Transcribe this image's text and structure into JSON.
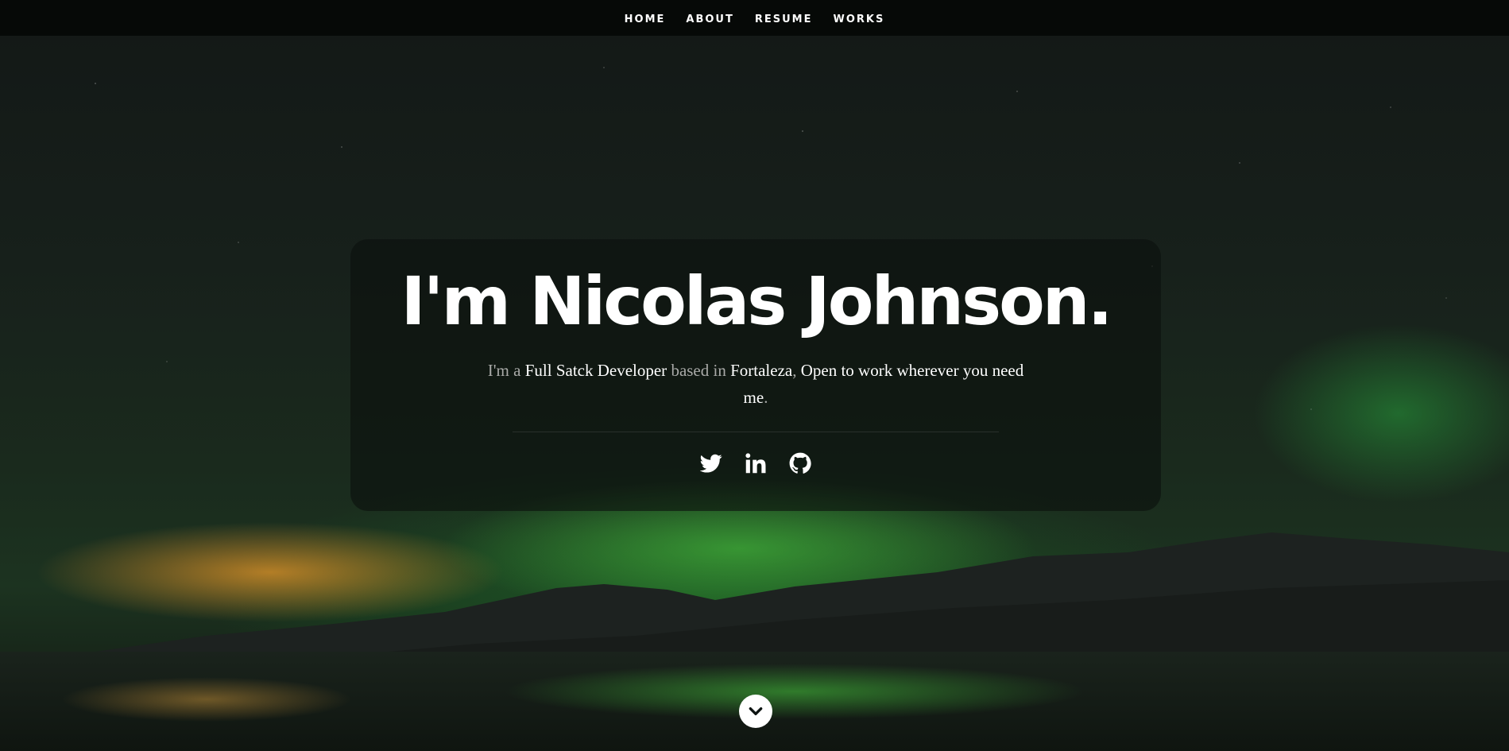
{
  "nav": {
    "items": [
      {
        "label": "HOME"
      },
      {
        "label": "ABOUT"
      },
      {
        "label": "RESUME"
      },
      {
        "label": "WORKS"
      }
    ]
  },
  "hero": {
    "title": "I'm Nicolas Johnson.",
    "desc": {
      "p1": "I'm a ",
      "role": "Full Satck Developer",
      "p2": " based in ",
      "city": "Fortaleza",
      "p3": ", ",
      "open": "Open to work wherever you need me",
      "p4": "."
    }
  },
  "social": [
    {
      "name": "twitter-icon"
    },
    {
      "name": "linkedin-icon"
    },
    {
      "name": "github-icon"
    }
  ],
  "scroll": {
    "icon": "chevron-down-icon"
  },
  "colors": {
    "nav_bg": "#050706",
    "card_bg": "#0c100d",
    "text_primary": "#ffffff",
    "text_muted": "#a9aaa8",
    "aurora_green": "#46be3c",
    "glow_orange": "#e6962a"
  }
}
